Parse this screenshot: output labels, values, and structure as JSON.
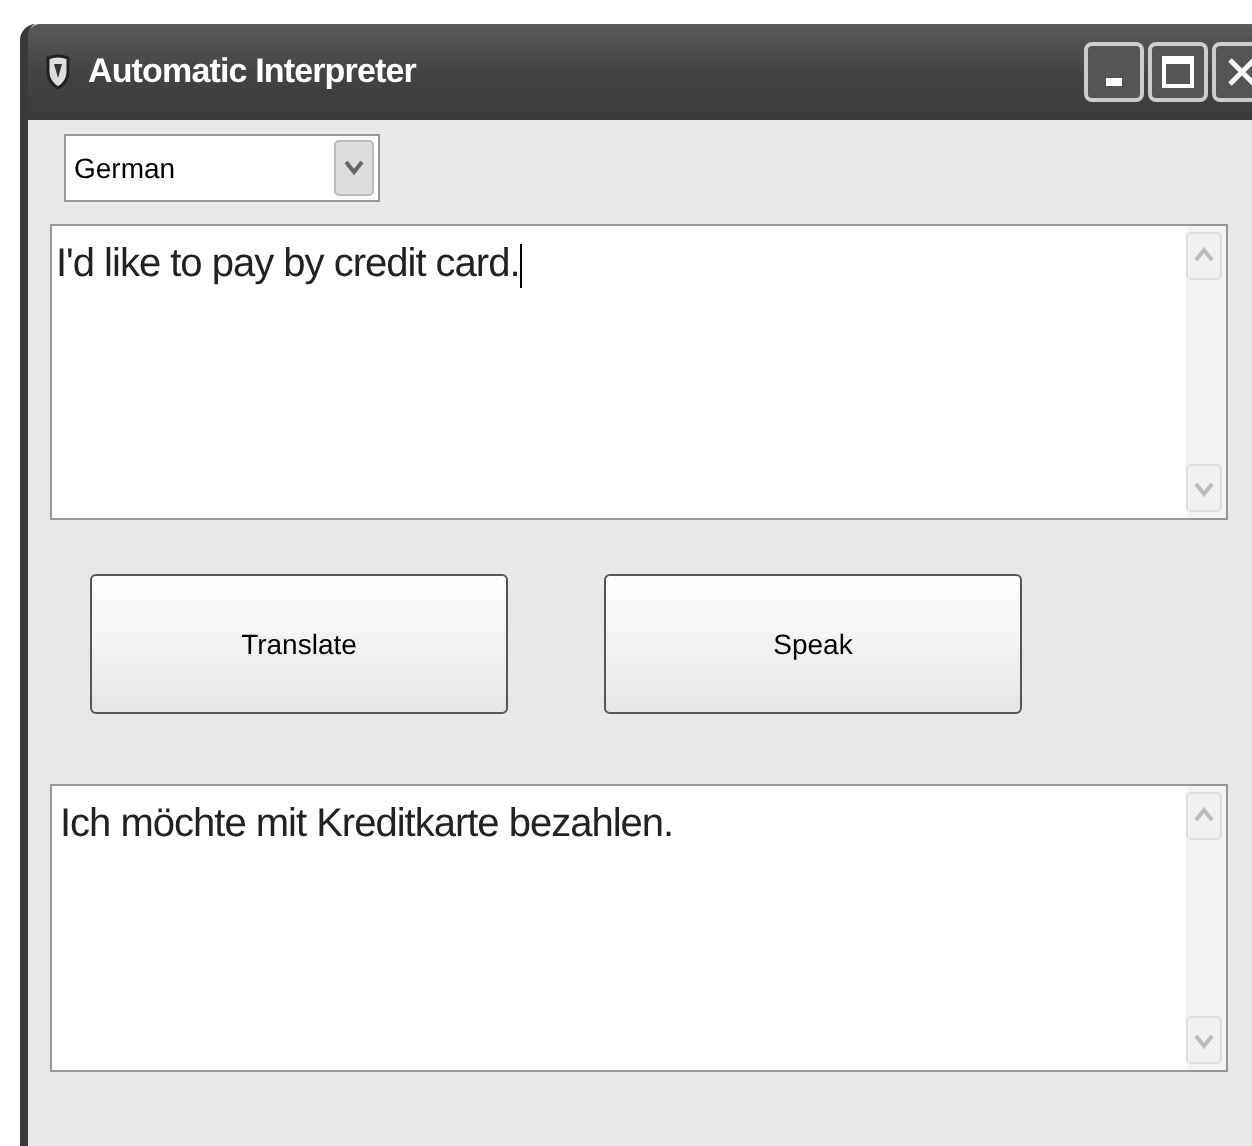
{
  "window": {
    "title": "Automatic Interpreter"
  },
  "language_dropdown": {
    "value": "German"
  },
  "input_box": {
    "value": "I'd like to pay by credit card.",
    "focused": true
  },
  "buttons": [
    {
      "label": "Translate"
    },
    {
      "label": "Speak"
    }
  ],
  "output_box": {
    "value": "Ich möchte mit Kreditkarte bezahlen."
  }
}
